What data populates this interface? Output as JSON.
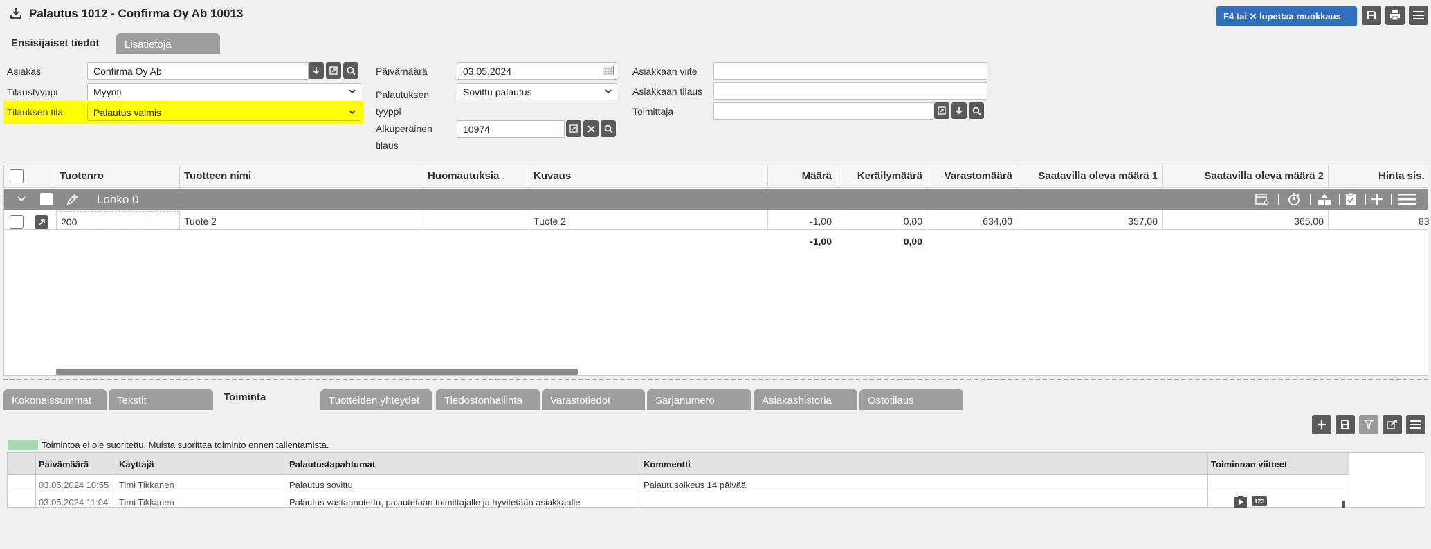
{
  "header": {
    "title": "Palautus 1012 - Confirma Oy Ab 10013",
    "edit_button_label": "F4 tai ✕ lopettaa muokkaus"
  },
  "top_tabs": [
    {
      "label": "Ensisijaiset tiedot"
    },
    {
      "label": "Lisätietoja"
    }
  ],
  "form": {
    "asiakas_label": "Asiakas",
    "asiakas_value": "Confirma Oy Ab",
    "tilaustyyppi_label": "Tilaustyyppi",
    "tilaustyyppi_value": "Myynti",
    "tilauksen_tila_label": "Tilauksen tila",
    "tilauksen_tila_value": "Palautus valmis",
    "paivamaara_label": "Päivämäärä",
    "paivamaara_value": "03.05.2024",
    "palautuksen_tyyppi_label_1": "Palautuksen",
    "palautuksen_tyyppi_label_2": "tyyppi",
    "palautuksen_tyyppi_value": "Sovittu palautus",
    "alkuperainen_label_1": "Alkuperäinen",
    "alkuperainen_label_2": "tilaus",
    "alkuperainen_value": "10974",
    "asiakkaan_viite_label": "Asiakkaan viite",
    "asiakkaan_viite_value": "",
    "asiakkaan_tilaus_label": "Asiakkaan tilaus",
    "asiakkaan_tilaus_value": "",
    "toimittaja_label": "Toimittaja",
    "toimittaja_value": ""
  },
  "grid": {
    "headers": [
      "Tuotenro",
      "Tuotteen nimi",
      "Huomautuksia",
      "Kuvaus",
      "Määrä",
      "Keräilymäärä",
      "Varastomäärä",
      "Saatavilla oleva määrä 1",
      "Saatavilla oleva määrä 2",
      "Hinta sis. A"
    ],
    "group_label": "Lohko 0",
    "row": {
      "tuotenro": "200",
      "nimi": "Tuote 2",
      "huomautuksia": "",
      "kuvaus": "Tuote 2",
      "maara": "-1,00",
      "kerailymaara": "0,00",
      "varastomaara": "634,00",
      "saatavilla1": "357,00",
      "saatavilla2": "365,00",
      "hinta": "83"
    },
    "totals": {
      "maara": "-1,00",
      "kerailymaara": "0,00"
    }
  },
  "bottom_tabs": [
    {
      "label": "Kokonaissummat"
    },
    {
      "label": "Tekstit"
    },
    {
      "label": "Toiminta"
    },
    {
      "label": "Tuotteiden yhteydet"
    },
    {
      "label": "Tiedostonhallinta"
    },
    {
      "label": "Varastotiedot"
    },
    {
      "label": "Sarjanumero"
    },
    {
      "label": "Asiakashistoria"
    },
    {
      "label": "Ostotilaus"
    }
  ],
  "activity": {
    "legend_text": "Toimintoa ei ole suoritettu. Muista suorittaa toiminto ennen tallentamista.",
    "legend_color": "#a8d8b0",
    "headers": [
      "Päivämäärä",
      "Käyttäjä",
      "Palautustapahtumat",
      "Kommentti",
      "Toiminnan viitteet"
    ],
    "rows": [
      {
        "date": "03.05.2024 10:55",
        "user": "Timi Tikkanen",
        "event": "Palautus sovittu",
        "comment": "Palautusoikeus 14 päivää"
      },
      {
        "date": "03.05.2024 11:04",
        "user": "Timi Tikkanen",
        "event": "Palautus vastaanotettu, palautetaan toimittajalle ja hyvitetään asiakkaalle",
        "comment": ""
      }
    ],
    "badge_text": "123"
  },
  "colors": {
    "accent": "#2f6fbd",
    "highlight": "#ffff00",
    "group_bar": "#8c8c8c",
    "tab_inactive": "#9e9e9e"
  }
}
